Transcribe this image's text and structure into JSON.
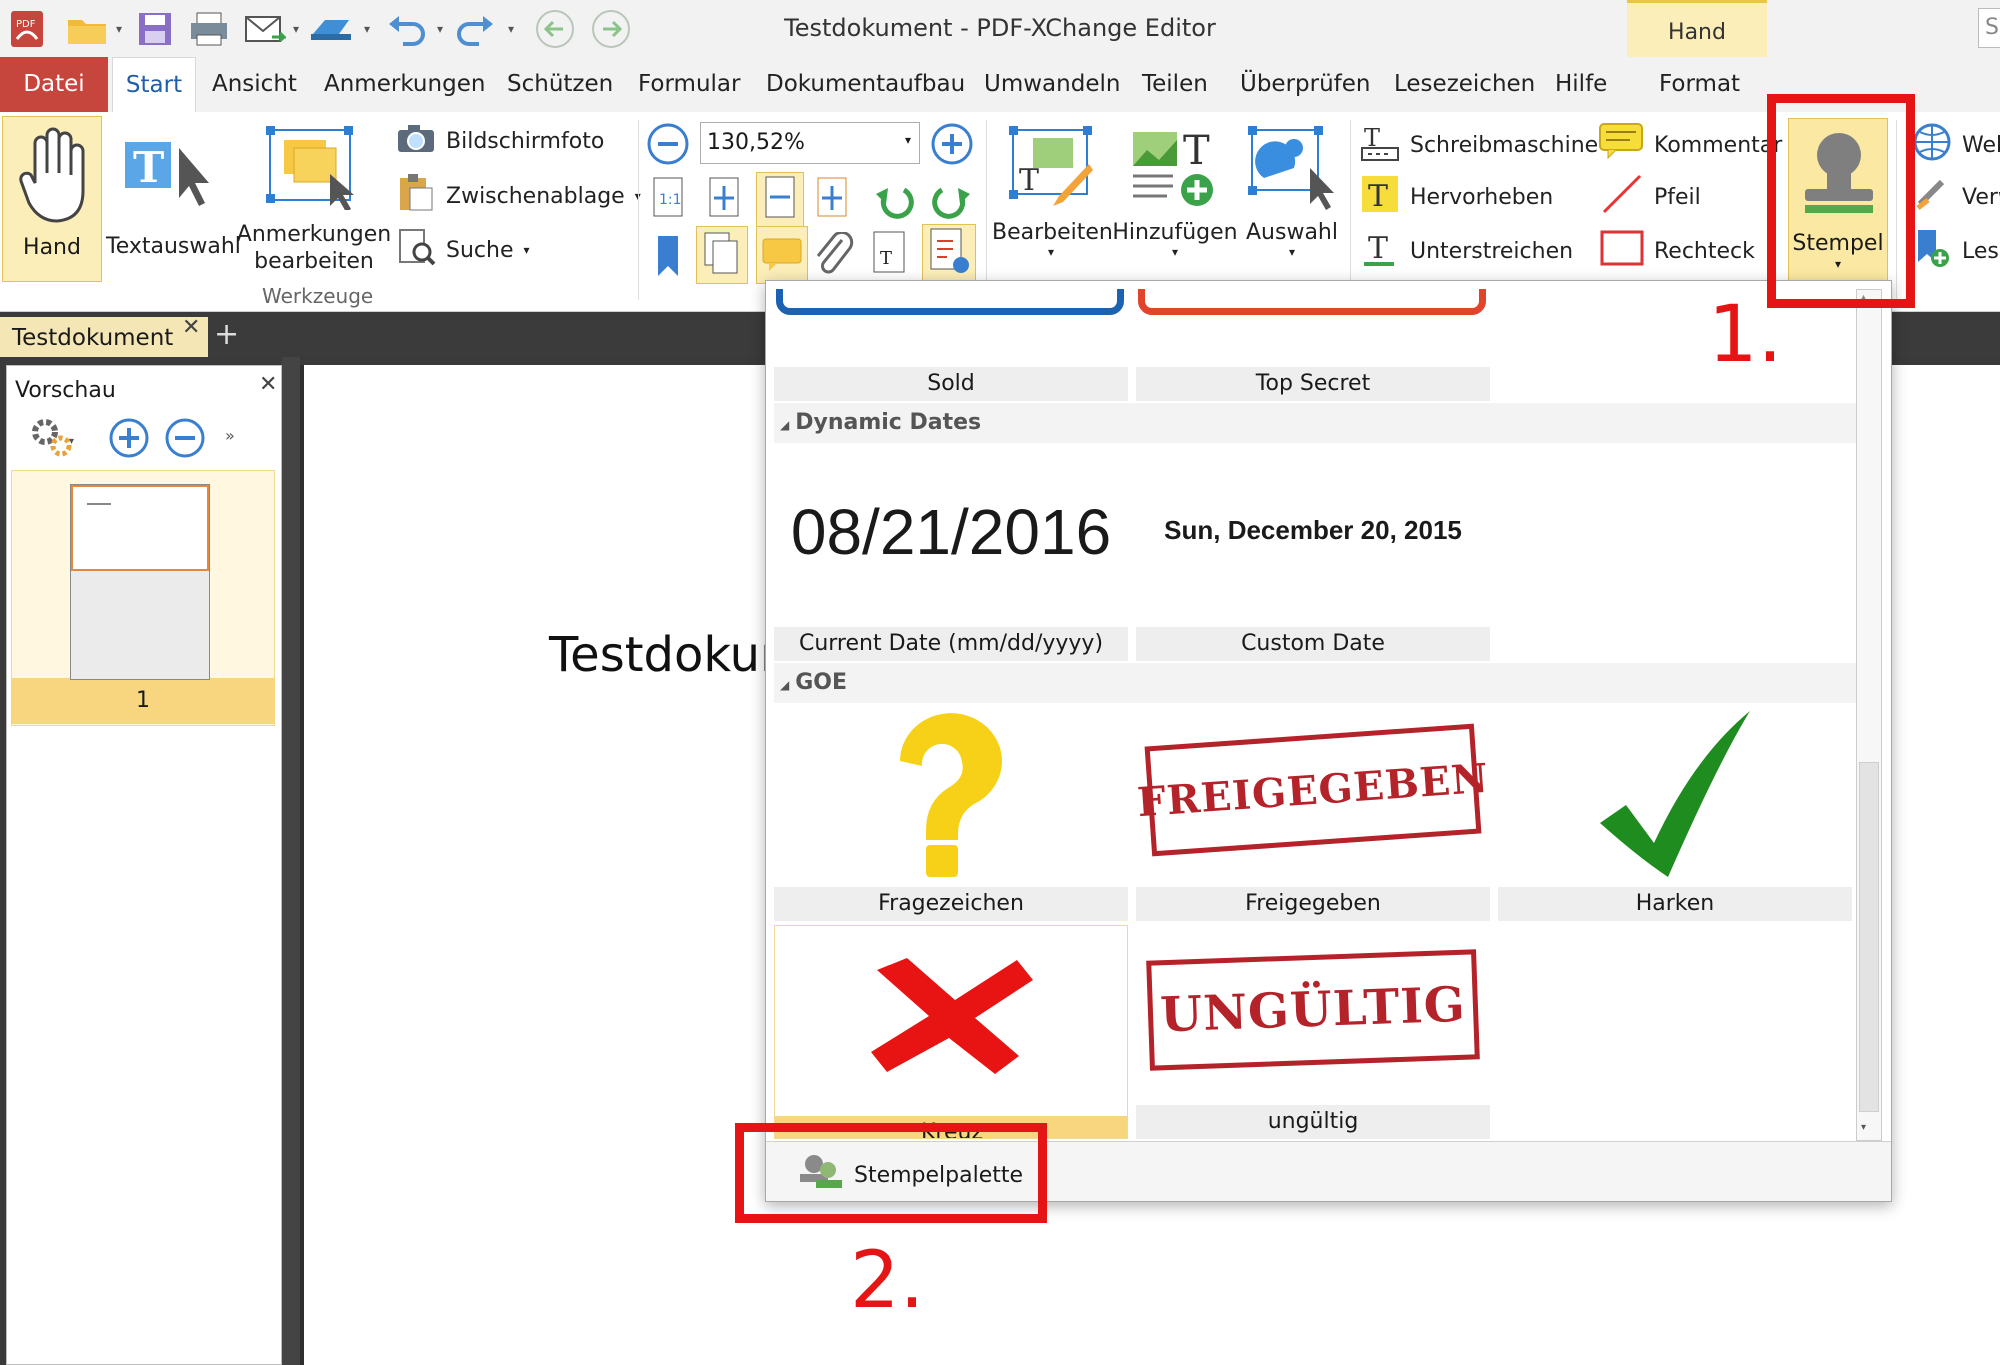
{
  "app": {
    "title": "Testdokument - PDF-XChange Editor",
    "context_tab": "Hand",
    "search_placeholder": "S"
  },
  "menu": {
    "tabs": [
      "Datei",
      "Start",
      "Ansicht",
      "Anmerkungen",
      "Schützen",
      "Formular",
      "Dokumentaufbau",
      "Umwandeln",
      "Teilen",
      "Überprüfen",
      "Lesezeichen",
      "Hilfe",
      "Format"
    ],
    "active": "Start"
  },
  "ribbon": {
    "hand": "Hand",
    "textauswahl": "Textauswahl",
    "anmerkungen_line1": "Anmerkungen",
    "anmerkungen_line2": "bearbeiten",
    "bildschirmfoto": "Bildschirmfoto",
    "zwischenablage": "Zwischenablage",
    "suche": "Suche",
    "group_label": "Werkzeuge",
    "zoom_value": "130,52%",
    "bearbeiten": "Bearbeiten",
    "hinzufuegen": "Hinzufügen",
    "auswahl": "Auswahl",
    "schreibmaschine": "Schreibmaschine",
    "hervorheben": "Hervorheben",
    "unterstreichen": "Unterstreichen",
    "kommentar": "Kommentar",
    "pfeil": "Pfeil",
    "rechteck": "Rechteck",
    "stempel": "Stempel",
    "web": "Web",
    "verw": "Verw",
    "lese": "Lese"
  },
  "document_tab": {
    "name": "Testdokument"
  },
  "sidebar": {
    "title": "Vorschau",
    "page_number": "1"
  },
  "document": {
    "text": "Testdokum"
  },
  "stamps": {
    "top_row": [
      "Sold",
      "Top Secret"
    ],
    "sections": [
      {
        "name": "Dynamic Dates",
        "items": [
          {
            "preview": "08/21/2016",
            "label": "Current Date (mm/dd/yyyy)"
          },
          {
            "preview": "Sun, December 20, 2015",
            "label": "Custom Date"
          }
        ]
      },
      {
        "name": "GOE",
        "items": [
          {
            "label": "Fragezeichen"
          },
          {
            "preview": "FREIGEGEBEN",
            "label": "Freigegeben"
          },
          {
            "label": "Harken"
          },
          {
            "label": "Kreuz"
          },
          {
            "preview": "UNGÜLTIG",
            "label": "ungültig"
          }
        ]
      }
    ],
    "palette_button": "Stempelpalette"
  },
  "annotations": {
    "step1": "1.",
    "step2": "2."
  },
  "colors": {
    "accent_red": "#e51515",
    "datei_tab": "#c6463e",
    "selection_yellow": "#fbeeb8",
    "stamp_red": "#b4222a",
    "check_green": "#1e8c1e"
  }
}
